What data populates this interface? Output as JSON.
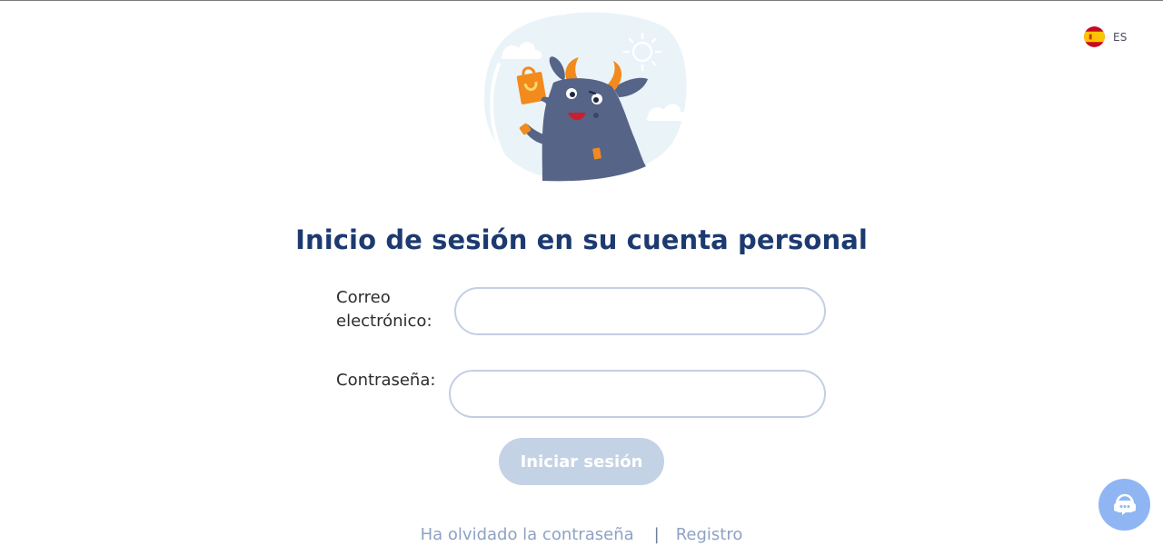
{
  "language": {
    "code": "ES",
    "flag_icon": "spain-flag-icon"
  },
  "illustration": {
    "icon": "cow-mascot-shopping-bag-illustration"
  },
  "login": {
    "title": "Inicio de sesión en su cuenta personal",
    "email_label": "Correo electrónico:",
    "email_value": "",
    "email_placeholder": "",
    "password_label": "Contraseña:",
    "password_value": "",
    "password_placeholder": "",
    "submit_label": "Iniciar sesión"
  },
  "links": {
    "forgot_password": "Ha olvidado la contraseña",
    "separator": "|",
    "register": "Registro"
  },
  "support": {
    "icon": "headset-chat-icon"
  },
  "colors": {
    "title": "#1d3a70",
    "input_border": "#c3cfe4",
    "submit_disabled_bg": "#c4d2e5",
    "link": "#8ea2c3",
    "support_bubble": "#8fb6f2",
    "mascot_body": "#566488",
    "mascot_accent": "#f28a1c"
  }
}
